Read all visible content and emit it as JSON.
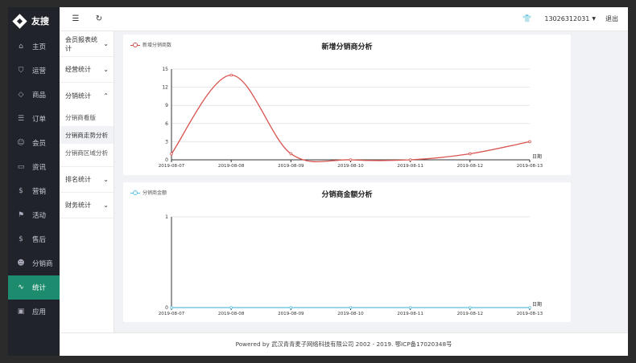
{
  "sidebar": {
    "logo": "友搜",
    "items": [
      {
        "label": "主页",
        "icon": "home-icon",
        "glyph": "⌂"
      },
      {
        "label": "运营",
        "icon": "shield-icon",
        "glyph": "⛉"
      },
      {
        "label": "商品",
        "icon": "tag-icon",
        "glyph": "◇"
      },
      {
        "label": "订单",
        "icon": "list-icon",
        "glyph": "☰"
      },
      {
        "label": "会员",
        "icon": "users-icon",
        "glyph": "☺"
      },
      {
        "label": "资讯",
        "icon": "chat-icon",
        "glyph": "▭"
      },
      {
        "label": "营销",
        "icon": "coin-icon",
        "glyph": "$"
      },
      {
        "label": "活动",
        "icon": "flag-icon",
        "glyph": "⚑"
      },
      {
        "label": "售后",
        "icon": "aftersale-icon",
        "glyph": "$"
      },
      {
        "label": "分销商",
        "icon": "user-icon",
        "glyph": "☻"
      },
      {
        "label": "统计",
        "icon": "stats-icon",
        "glyph": "∿"
      },
      {
        "label": "应用",
        "icon": "apps-icon",
        "glyph": "▣"
      }
    ],
    "active_index": 10
  },
  "topbar": {
    "phone": "13026312031",
    "logout": "退出"
  },
  "subnav": {
    "groups": [
      {
        "label": "会员报表统计"
      },
      {
        "label": "经营统计"
      },
      {
        "label": "分销统计"
      },
      {
        "label": "排名统计"
      },
      {
        "label": "财务统计"
      }
    ],
    "distribution_items": [
      "分销商看版",
      "分销商走势分析",
      "分销商区域分析"
    ],
    "active_item_index": 1
  },
  "chart_data": [
    {
      "type": "line",
      "title": "新增分销商分析",
      "series": [
        {
          "name": "新增分销商数",
          "color": "#d9534f"
        }
      ],
      "x": [
        "2019-08-07",
        "2019-08-08",
        "2019-08-09",
        "2019-08-10",
        "2019-08-11",
        "2019-08-12",
        "2019-08-13"
      ],
      "values": [
        1,
        14,
        1,
        0,
        0,
        1,
        3
      ],
      "xlabel": "日期",
      "ylim": [
        0,
        15
      ],
      "yticks": [
        0,
        3,
        6,
        9,
        12,
        15
      ],
      "grid": true,
      "legend": "top-left"
    },
    {
      "type": "line",
      "title": "分销商金额分析",
      "series": [
        {
          "name": "分销商金额",
          "color": "#5bc0de"
        }
      ],
      "x": [
        "2019-08-07",
        "2019-08-08",
        "2019-08-09",
        "2019-08-10",
        "2019-08-11",
        "2019-08-12",
        "2019-08-13"
      ],
      "values": [
        0,
        0,
        0,
        0,
        0,
        0,
        0
      ],
      "xlabel": "日期",
      "ylim": [
        0,
        1
      ],
      "yticks": [
        0,
        1
      ],
      "grid": true,
      "legend": "top-left"
    }
  ],
  "footer": {
    "text": "Powered by 武汉青青麦子网络科技有限公司 2002 - 2019. 鄂ICP备17020348号"
  }
}
